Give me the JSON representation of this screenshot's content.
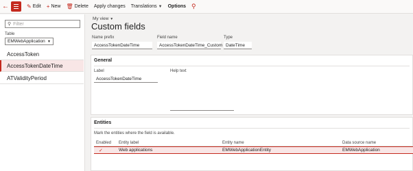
{
  "toolbar": {
    "edit": "Edit",
    "new": "New",
    "delete": "Delete",
    "apply_changes": "Apply changes",
    "translations": "Translations",
    "options": "Options"
  },
  "left": {
    "filter_placeholder": "Filter",
    "table_label": "Table",
    "table_value": "EMWebApplication",
    "items": [
      "AccessToken",
      "AccessTokenDateTime",
      "ATValidityPeriod"
    ],
    "selected_index": 1
  },
  "main": {
    "view_label": "My view",
    "title": "Custom fields",
    "name_prefix_label": "Name prefix",
    "name_prefix_value": "AccessTokenDateTime",
    "field_name_label": "Field name",
    "field_name_value": "AccessTokenDateTime_Custom",
    "type_label": "Type",
    "type_value": "DateTime",
    "general": {
      "title": "General",
      "label_label": "Label",
      "label_value": "AccessTokenDateTime",
      "help_text_label": "Help text"
    },
    "entities": {
      "title": "Entities",
      "hint": "Mark the entities where the field is available.",
      "columns": [
        "Enabled",
        "Entity label",
        "Entity name",
        "Data source name"
      ],
      "rows": [
        {
          "enabled": "✓",
          "label": "Web applications",
          "name": "EMWebApplicationEntity",
          "source": "EMWebApplication"
        }
      ]
    }
  },
  "colors": {
    "accent": "#c4281d",
    "selection": "#f8e6e6"
  }
}
